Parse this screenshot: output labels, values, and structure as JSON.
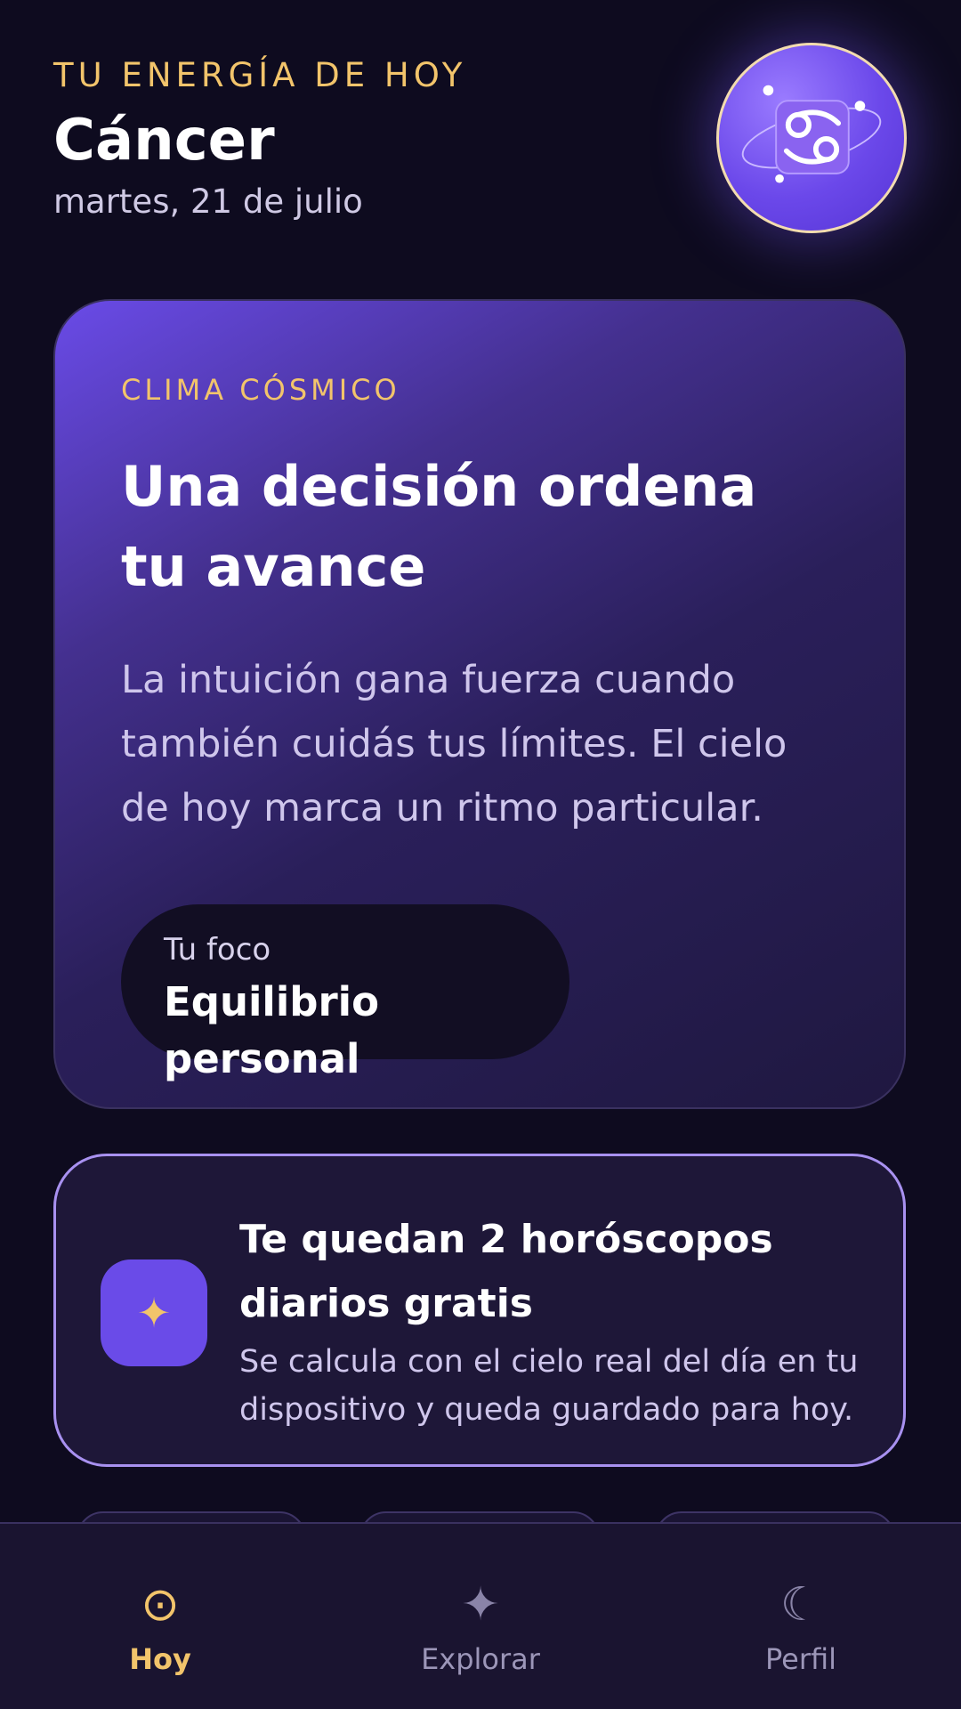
{
  "header": {
    "eyebrow": "TU ENERGÍA DE HOY",
    "sign_name": "Cáncer",
    "date": "martes, 21 de julio",
    "avatar_icon": "cancer-zodiac-icon"
  },
  "cosmic_card": {
    "eyebrow": "CLIMA CÓSMICO",
    "title": "Una decisión ordena tu avance",
    "body": "La intuición gana fuerza cuando también cuidás tus límites. El cielo de hoy marca un ritmo particular.",
    "focus": {
      "label": "Tu foco",
      "value": "Equilibrio personal"
    }
  },
  "free_card": {
    "icon": "sparkle-icon",
    "icon_glyph": "✦",
    "title": "Te quedan 2 horóscopos diarios gratis",
    "subtitle": "Se calcula con el cielo real del día en tu dispositivo y queda guardado para hoy."
  },
  "nav": {
    "items": [
      {
        "label": "Hoy",
        "icon": "sun-icon",
        "glyph": "⊙",
        "active": true
      },
      {
        "label": "Explorar",
        "icon": "star-icon",
        "glyph": "✦",
        "active": false
      },
      {
        "label": "Perfil",
        "icon": "moon-icon",
        "glyph": "☾",
        "active": false
      }
    ]
  },
  "colors": {
    "background": "#0e0b1f",
    "accent_gold": "#f2c46b",
    "accent_purple": "#6a4be8",
    "card_border": "#a891f0"
  }
}
